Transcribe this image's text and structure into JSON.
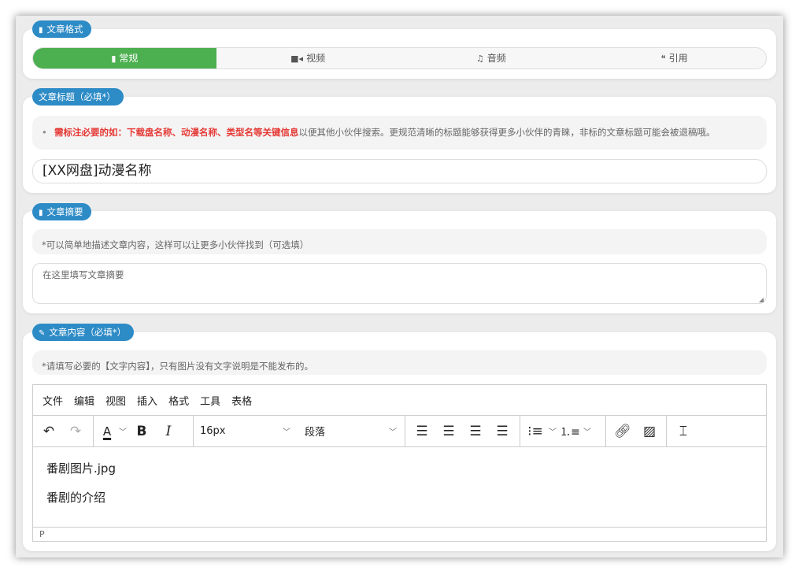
{
  "format": {
    "label": "文章格式",
    "tabs": [
      {
        "label": "常规",
        "icon": "file-icon"
      },
      {
        "label": "视频",
        "icon": "video-icon"
      },
      {
        "label": "音频",
        "icon": "music-icon"
      },
      {
        "label": "引用",
        "icon": "quote-icon"
      }
    ],
    "active": "常规"
  },
  "title": {
    "label": "文章标题（必填*）",
    "hint_red": "需标注必要的如：下载盘名称、动漫名称、类型名等关键信息",
    "hint_rest": "以便其他小伙伴搜索。更规范清晰的标题能够获得更多小伙伴的青睐，非标的文章标题可能会被退稿哦。",
    "value": "[XX网盘]动漫名称"
  },
  "summary": {
    "label": "文章摘要",
    "hint": "*可以简单地描述文章内容，这样可以让更多小伙伴找到（可选填）",
    "placeholder": "在这里填写文章摘要"
  },
  "content": {
    "label": "文章内容（必填*）",
    "hint": "*请填写必要的【文字内容】，只有图片没有文字说明是不能发布的。",
    "menu": [
      "文件",
      "编辑",
      "视图",
      "插入",
      "格式",
      "工具",
      "表格"
    ],
    "font_size": "16px",
    "block_format": "段落",
    "paragraphs": [
      "番剧图片.jpg",
      "番剧的介绍"
    ],
    "status_path": "P"
  },
  "colors": {
    "accent": "#2d8bc6",
    "active_tab": "#4caf50",
    "hint_red": "#e53935"
  }
}
